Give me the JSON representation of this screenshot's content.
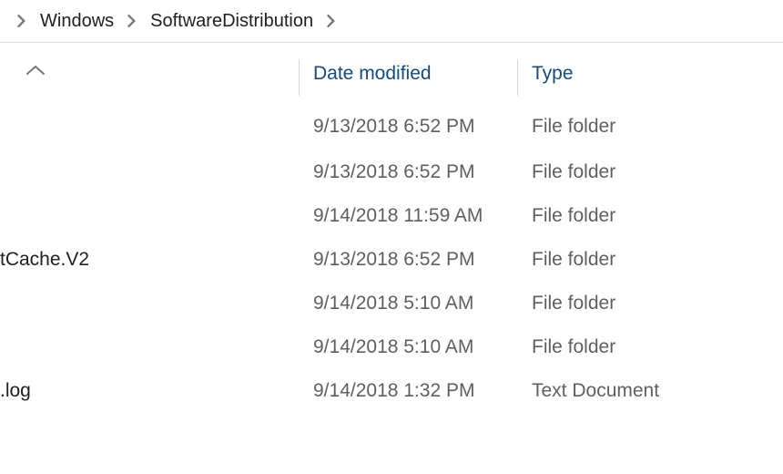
{
  "breadcrumb": {
    "segments": [
      "Windows",
      "SoftwareDistribution"
    ]
  },
  "columns": {
    "date_modified": "Date modified",
    "type": "Type"
  },
  "rows": [
    {
      "name": "",
      "date": "9/13/2018 6:52 PM",
      "type": "File folder"
    },
    {
      "name": "",
      "date": "9/13/2018 6:52 PM",
      "type": "File folder"
    },
    {
      "name": "",
      "date": "9/14/2018 11:59 AM",
      "type": "File folder"
    },
    {
      "name": "tCache.V2",
      "date": "9/13/2018 6:52 PM",
      "type": "File folder"
    },
    {
      "name": "",
      "date": "9/14/2018 5:10 AM",
      "type": "File folder"
    },
    {
      "name": "",
      "date": "9/14/2018 5:10 AM",
      "type": "File folder"
    },
    {
      "name": ".log",
      "date": "9/14/2018 1:32 PM",
      "type": "Text Document"
    }
  ]
}
